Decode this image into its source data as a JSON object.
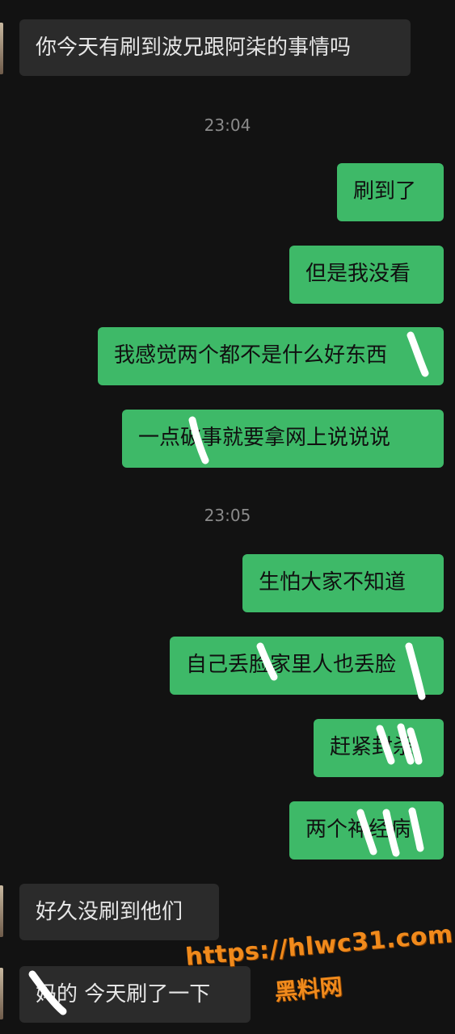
{
  "messages": [
    {
      "text": "你今天有刷到波兄跟阿柒的事情吗",
      "dir": "in"
    },
    {
      "time": "23:04"
    },
    {
      "text": "刷到了",
      "dir": "out"
    },
    {
      "text": "但是我没看",
      "dir": "out"
    },
    {
      "text": "我感觉两个都不是什么好东西",
      "dir": "out"
    },
    {
      "text": "一点破事就要拿网上说说说",
      "dir": "out"
    },
    {
      "time": "23:05"
    },
    {
      "text": "生怕大家不知道",
      "dir": "out"
    },
    {
      "text": "自己丢脸家里人也丢脸",
      "dir": "out"
    },
    {
      "text": "赶紧封杀",
      "dir": "out"
    },
    {
      "text": "两个神经病",
      "dir": "out"
    },
    {
      "text": "好久没刷到他们",
      "dir": "in"
    },
    {
      "text": "妈的 今天刷了一下",
      "dir": "in"
    }
  ],
  "watermark": {
    "url": "https://hlwc31.com",
    "name": "黑料网"
  },
  "colors": {
    "background": "#121212",
    "outgoing": "#3eb968",
    "incoming": "#2b2b2b",
    "watermark": "#f08a1c"
  }
}
